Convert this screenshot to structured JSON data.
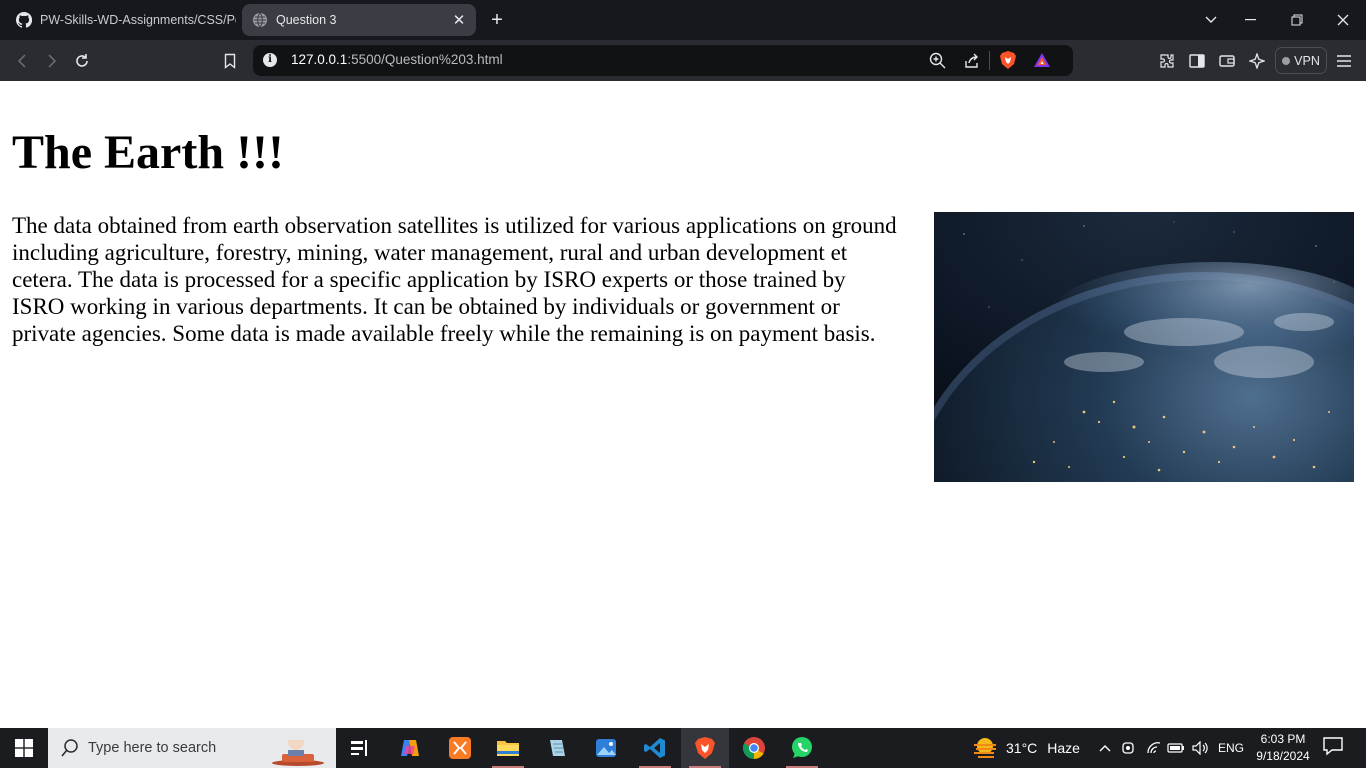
{
  "browser": {
    "tabs": [
      {
        "title": "PW-Skills-WD-Assignments/CSS/Po",
        "active": false,
        "favicon": "github-icon"
      },
      {
        "title": "Question 3",
        "active": true,
        "favicon": "globe-icon"
      }
    ],
    "address": {
      "host": "127.0.0.1",
      "rest": ":5500/Question%203.html"
    },
    "vpn_label": "VPN"
  },
  "page": {
    "heading": "The Earth !!!",
    "paragraph": "The data obtained from earth observation satellites is utilized for various applications on ground including agriculture, forestry, mining, water management, rural and urban development et cetera. The data is processed for a specific application by ISRO experts or those trained by ISRO working in various departments. It can be obtained by individuals or government or private agencies. Some data is made available freely while the remaining is on payment basis.",
    "image": "earth-from-space-image"
  },
  "taskbar": {
    "search_placeholder": "Type here to search",
    "weather": {
      "temp": "31°C",
      "condition": "Haze"
    },
    "language": "ENG",
    "time": "6:03 PM",
    "date": "9/18/2024"
  },
  "colors": {
    "tabstrip": "#16181d",
    "toolbar": "#2a2c31",
    "taskbar": "#1b1c20",
    "brave_orange": "#fb542b"
  }
}
